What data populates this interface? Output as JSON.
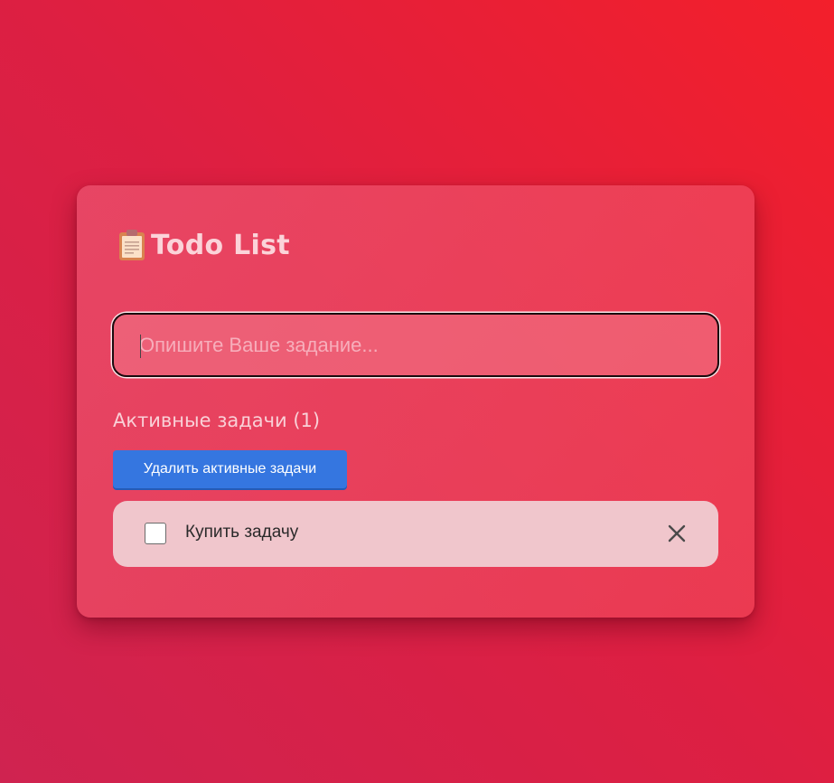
{
  "header": {
    "icon": "clipboard-icon",
    "title": "Todo List"
  },
  "task_input": {
    "placeholder": "Опишите Ваше задание...",
    "value": ""
  },
  "active_section": {
    "label": "Активные задачи (1)",
    "delete_button_label": "Удалить активные задачи"
  },
  "tasks": [
    {
      "text": "Купить задачу",
      "completed": false,
      "remove_icon": "close-icon"
    }
  ],
  "colors": {
    "accent_button": "#3576e0",
    "title": "#fbd3d9",
    "task_item_bg": "#f0c6cc"
  }
}
